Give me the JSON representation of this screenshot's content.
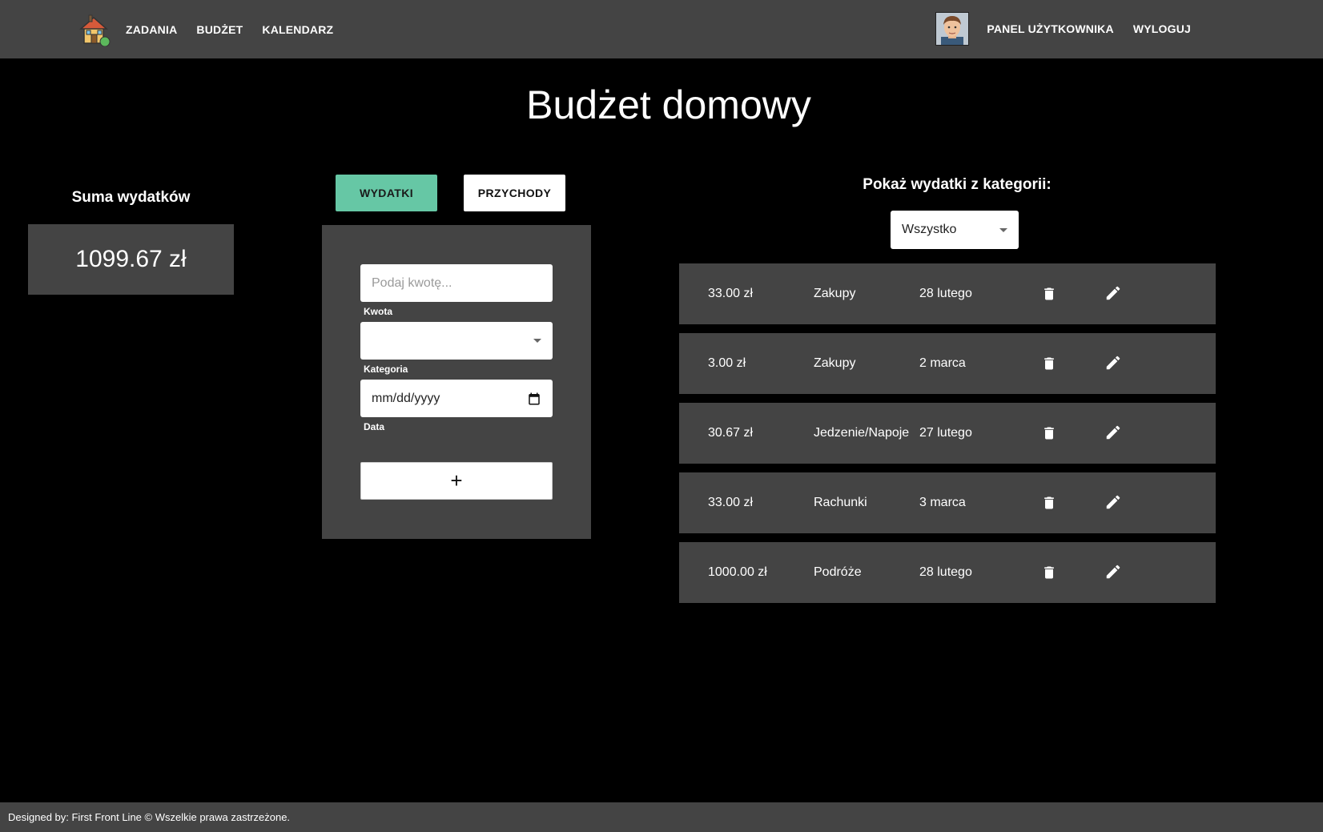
{
  "nav": {
    "left_links": [
      "ZADANIA",
      "BUDŻET",
      "KALENDARZ"
    ],
    "user_panel": "PANEL UŻYTKOWNIKA",
    "logout": "WYLOGUJ"
  },
  "page": {
    "title": "Budżet domowy"
  },
  "summary": {
    "label": "Suma wydatków",
    "total": "1099.67 zł"
  },
  "tabs": {
    "expenses": "WYDATKI",
    "incomes": "PRZYCHODY"
  },
  "form": {
    "amount_placeholder": "Podaj kwotę...",
    "amount_label": "Kwota",
    "category_value": "",
    "category_label": "Kategoria",
    "date_placeholder": "mm/dd/yyyy",
    "date_label": "Data",
    "add_symbol": "+"
  },
  "filter": {
    "label": "Pokaż wydatki z kategorii:",
    "selected": "Wszystko"
  },
  "expenses": [
    {
      "amount": "33.00 zł",
      "category": "Zakupy",
      "date": "28 lutego"
    },
    {
      "amount": "3.00 zł",
      "category": "Zakupy",
      "date": "2 marca"
    },
    {
      "amount": "30.67 zł",
      "category": "Jedzenie/Napoje",
      "date": "27 lutego"
    },
    {
      "amount": "33.00 zł",
      "category": "Rachunki",
      "date": "3 marca"
    },
    {
      "amount": "1000.00 zł",
      "category": "Podróże",
      "date": "28 lutego"
    }
  ],
  "icons": {
    "logo": "house-icon",
    "avatar": "user-avatar",
    "delete": "trash-icon",
    "edit": "pencil-icon",
    "calendar": "calendar-icon",
    "dropdown": "caret-down-icon"
  },
  "colors": {
    "background": "#000000",
    "panel": "#444444",
    "accent": "#66c7a5",
    "text": "#ffffff"
  },
  "footer": {
    "text": "Designed by: First Front Line © Wszelkie prawa zastrzeżone."
  }
}
